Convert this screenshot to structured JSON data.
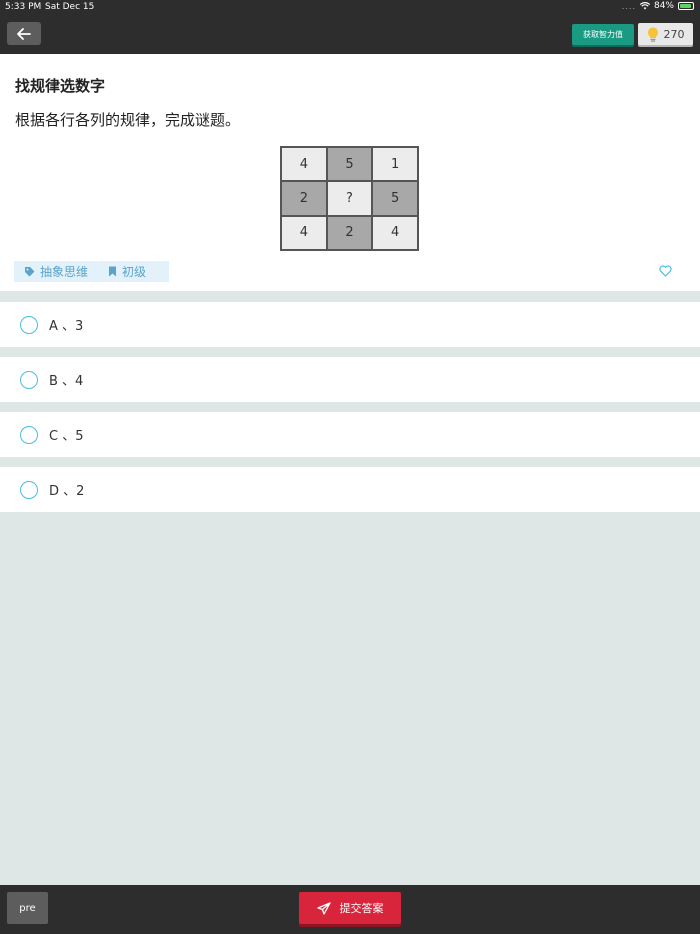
{
  "status_bar": {
    "time": "5:33 PM",
    "date": "Sat Dec 15",
    "battery": "84%"
  },
  "header": {
    "get_iq_label": "获取智力值",
    "score": "270"
  },
  "question": {
    "title": "找规律选数字",
    "text": "根据各行各列的规律，完成谜题。",
    "grid": [
      [
        "4",
        "5",
        "1"
      ],
      [
        "2",
        "?",
        "5"
      ],
      [
        "4",
        "2",
        "4"
      ]
    ],
    "tags": {
      "category": "抽象思维",
      "level": "初级"
    }
  },
  "options": [
    {
      "label": "A 、3"
    },
    {
      "label": "B 、4"
    },
    {
      "label": "C 、5"
    },
    {
      "label": "D 、2"
    }
  ],
  "footer": {
    "pre_label": "pre",
    "submit_label": "提交答案"
  },
  "colors": {
    "accent": "#4bbde0",
    "submit": "#d8253b",
    "get_iq": "#1a9a83",
    "bars": "#2d2d2d"
  }
}
